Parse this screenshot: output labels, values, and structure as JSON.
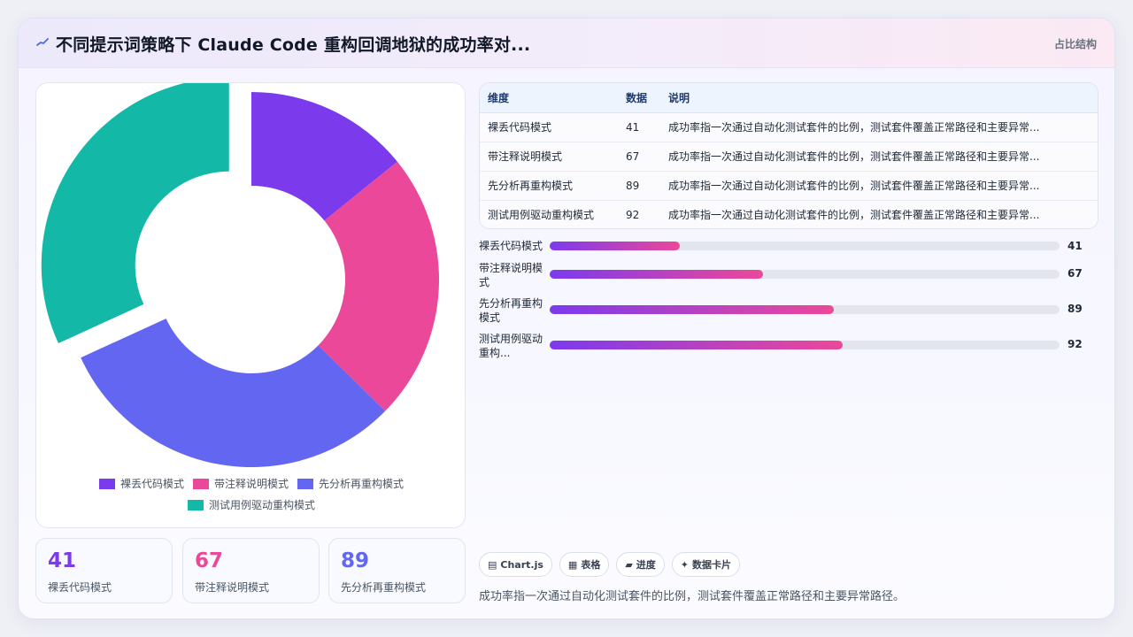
{
  "header": {
    "title": "不同提示词策略下 Claude Code 重构回调地狱的成功率对...",
    "chart_type_label": "占比结构"
  },
  "colors": {
    "accent": "#7c3aed",
    "series": [
      "#7c3aed",
      "#ec4899",
      "#6366f1",
      "#14b8a6"
    ]
  },
  "chart_data": {
    "type": "pie",
    "variant": "donut",
    "exploded_slice": "测试用例驱动重构模式",
    "categories": [
      "裸丢代码模式",
      "带注释说明模式",
      "先分析再重构模式",
      "测试用例驱动重构模式"
    ],
    "values": [
      41,
      67,
      89,
      92
    ],
    "legend_position": "bottom"
  },
  "legend": [
    "裸丢代码模式",
    "带注释说明模式",
    "先分析再重构模式",
    "测试用例驱动重构模式"
  ],
  "stats": [
    {
      "value": "41",
      "label": "裸丢代码模式",
      "color": "#7c3aed"
    },
    {
      "value": "67",
      "label": "带注释说明模式",
      "color": "#ec4899"
    },
    {
      "value": "89",
      "label": "先分析再重构模式",
      "color": "#6366f1"
    }
  ],
  "table": {
    "headers": [
      "维度",
      "数据",
      "说明"
    ],
    "rows": [
      [
        "裸丢代码模式",
        "41",
        "成功率指一次通过自动化测试套件的比例，测试套件覆盖正常路径和主要异常..."
      ],
      [
        "带注释说明模式",
        "67",
        "成功率指一次通过自动化测试套件的比例，测试套件覆盖正常路径和主要异常..."
      ],
      [
        "先分析再重构模式",
        "89",
        "成功率指一次通过自动化测试套件的比例，测试套件覆盖正常路径和主要异常..."
      ],
      [
        "测试用例驱动重构模式",
        "92",
        "成功率指一次通过自动化测试套件的比例，测试套件覆盖正常路径和主要异常..."
      ]
    ]
  },
  "progress": [
    {
      "label": "裸丢代码模式",
      "value": 41,
      "fill_fraction": 0.255
    },
    {
      "label": "带注释说明模式",
      "value": 67,
      "fill_fraction": 0.418
    },
    {
      "label": "先分析再重构模式",
      "value": 89,
      "fill_fraction": 0.557
    },
    {
      "label": "测试用例驱动重构...",
      "value": 92,
      "fill_fraction": 0.575
    }
  ],
  "chips": [
    {
      "icon": "▤",
      "label": "Chart.js"
    },
    {
      "icon": "▦",
      "label": "表格"
    },
    {
      "icon": "▰",
      "label": "进度"
    },
    {
      "icon": "✦",
      "label": "数据卡片"
    }
  ],
  "footnote": "成功率指一次通过自动化测试套件的比例，测试套件覆盖正常路径和主要异常路径。"
}
